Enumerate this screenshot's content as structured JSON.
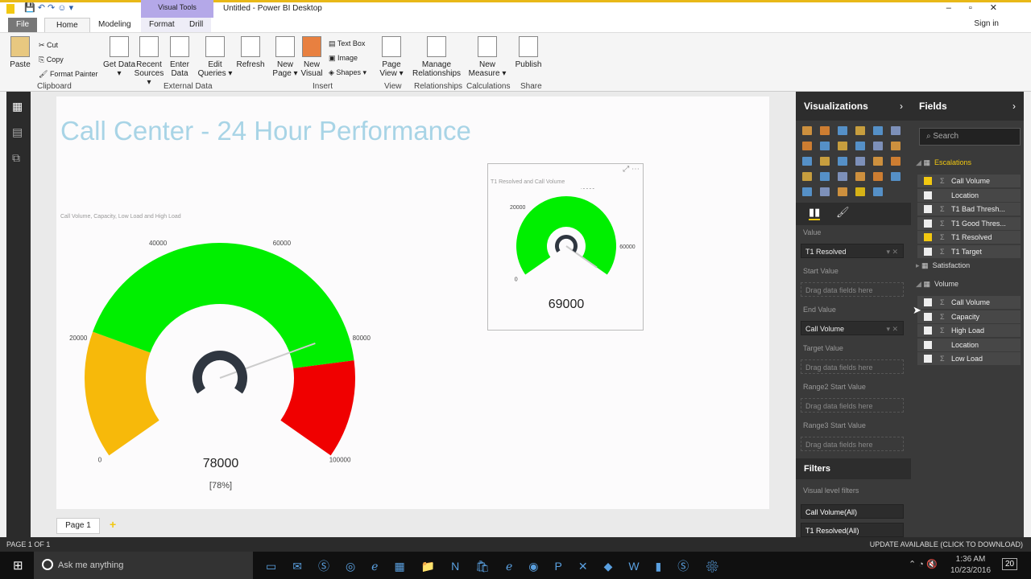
{
  "window": {
    "title": "Untitled - Power BI Desktop",
    "context_tab": "Visual Tools",
    "sign_in": "Sign in"
  },
  "tabs": [
    "File",
    "Home",
    "Modeling",
    "Format",
    "Drill"
  ],
  "ribbon": {
    "clipboard": {
      "paste": "Paste",
      "cut": "Cut",
      "copy": "Copy",
      "format_painter": "Format Painter",
      "group": "Clipboard"
    },
    "buttons": [
      {
        "label": "Get Data ▾"
      },
      {
        "label": "Recent Sources ▾"
      },
      {
        "label": "Enter Data"
      },
      {
        "label": "Edit Queries ▾"
      },
      {
        "label": "Refresh"
      },
      {
        "label": "New Page ▾"
      },
      {
        "label": "New Visual"
      },
      {
        "label": "Page View ▾"
      },
      {
        "label": "Manage Relationships"
      },
      {
        "label": "New Measure ▾"
      },
      {
        "label": "Publish"
      }
    ],
    "insert_small": [
      "Text Box",
      "Image",
      "Shapes ▾"
    ],
    "groups": [
      "External Data",
      "Insert",
      "View",
      "Relationships",
      "Calculations",
      "Share"
    ]
  },
  "report": {
    "title": "Call Center - 24 Hour Performance",
    "big_gauge": {
      "caption": "Call Volume, Capacity, Low Load and High Load",
      "value": "78000",
      "percent": "[78%]",
      "value_num": 78000,
      "min": 0,
      "max": 100000,
      "ticks": [
        "0",
        "20000",
        "40000",
        "60000",
        "80000",
        "100000"
      ],
      "ranges": [
        {
          "from": 0,
          "to": 22000,
          "color": "#f7b90a"
        },
        {
          "from": 22000,
          "to": 83000,
          "color": "#00ef00"
        },
        {
          "from": 83000,
          "to": 100000,
          "color": "#f00000"
        }
      ]
    },
    "small_gauge": {
      "caption": "T1 Resolved and Call Volume",
      "value": "69000",
      "value_num": 69000,
      "min": 0,
      "max": 69000,
      "ticks": [
        "0",
        "20000",
        "40000",
        "60000"
      ],
      "color": "#00ef00"
    }
  },
  "pages": {
    "tab": "Page 1",
    "add": "+",
    "status": "PAGE 1 OF 1",
    "update": "UPDATE AVAILABLE (CLICK TO DOWNLOAD)"
  },
  "visualizations": {
    "title": "Visualizations",
    "wells": [
      {
        "label": "Value",
        "field": "T1 Resolved"
      },
      {
        "label": "Start Value",
        "field": "Drag data fields here"
      },
      {
        "label": "End Value",
        "field": "Call Volume"
      },
      {
        "label": "Target Value",
        "field": "Drag data fields here"
      },
      {
        "label": "Range2 Start Value",
        "field": "Drag data fields here"
      },
      {
        "label": "Range3 Start Value",
        "field": "Drag data fields here"
      }
    ],
    "filters": {
      "title": "Filters",
      "subtitle": "Visual level filters",
      "items": [
        "Call Volume(All)",
        "T1 Resolved(All)"
      ]
    }
  },
  "fields": {
    "title": "Fields",
    "search_placeholder": "Search",
    "tables": [
      {
        "name": "Escalations",
        "items": [
          {
            "name": "Call Volume",
            "checked": true
          },
          {
            "name": "Location",
            "checked": false
          },
          {
            "name": "T1 Bad Thresh...",
            "checked": false
          },
          {
            "name": "T1 Good Thres...",
            "checked": false
          },
          {
            "name": "T1 Resolved",
            "checked": true
          },
          {
            "name": "T1 Target",
            "checked": false
          }
        ]
      },
      {
        "name": "Satisfaction",
        "items": []
      },
      {
        "name": "Volume",
        "items": [
          {
            "name": "Call Volume",
            "checked": false
          },
          {
            "name": "Capacity",
            "checked": false
          },
          {
            "name": "High Load",
            "checked": false
          },
          {
            "name": "Location",
            "checked": false
          },
          {
            "name": "Low Load",
            "checked": false
          }
        ]
      }
    ]
  },
  "taskbar": {
    "search": "Ask me anything",
    "time": "1:36 AM",
    "date": "10/23/2016",
    "notifications": "20"
  },
  "colors": {
    "accent": "#f2c811",
    "title": "#a8d4e6"
  }
}
